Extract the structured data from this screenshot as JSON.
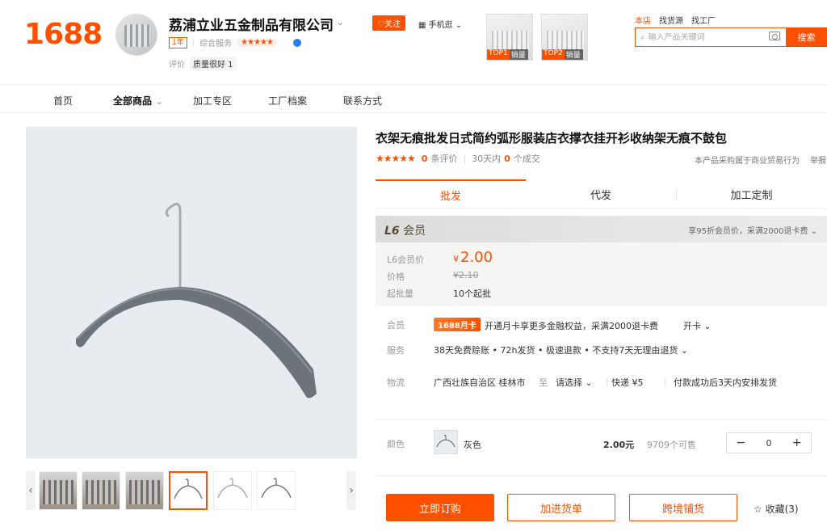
{
  "header": {
    "logo": "1688",
    "shop_name": "荔浦立业五金制品有限公司",
    "year_badge": "1年",
    "service_label": "综合服务",
    "service_stars": "★★★★★",
    "eval_label": "评价",
    "eval_tag": "质量很好 1",
    "follow": "♡关注",
    "mobile": "▦ 手机逛 ⌄",
    "top_products": [
      {
        "rank": "TOP1",
        "label": "销量"
      },
      {
        "rank": "TOP2",
        "label": "销量"
      }
    ],
    "search_tabs": [
      "本店",
      "找货源",
      "找工厂"
    ],
    "search_placeholder": "输入产品关键词",
    "search_button": "搜索"
  },
  "nav": [
    "首页",
    "全部商品",
    "加工专区",
    "工厂档案",
    "联系方式"
  ],
  "gallery": {
    "prev": "‹",
    "next": "›"
  },
  "product": {
    "title": "衣架无痕批发日式简约弧形服装店衣撑衣挂开衫收纳架无痕不鼓包",
    "stars": "★★★★★",
    "review_count": "0",
    "review_label": "条评价",
    "days_label": "30天内",
    "deal_count": "0",
    "deal_label": "个成交",
    "trade_note": "本产品采购属于商业贸易行为",
    "report": "举报"
  },
  "tabs": [
    "批发",
    "代发",
    "加工定制"
  ],
  "price": {
    "member_level": "L6",
    "member_word": "会员",
    "benefit": "享95折会员价，采满2000退卡费 ⌄",
    "member_price_label": "L6会员价",
    "currency": "¥",
    "member_price": "2.00",
    "price_label": "价格",
    "orig_price": "¥2.10",
    "moq_label": "起批量",
    "moq": "10个起批"
  },
  "info": {
    "member_label": "会员",
    "card_badge": "1688月卡",
    "card_text": "开通月卡享更多金融权益，采满2000退卡费",
    "card_action": "开卡 ⌄",
    "service_label": "服务",
    "service_text": "38天免费赊账 • 72h发货 • 极速退款 • 不支持7天无理由退货 ⌄",
    "logistics_label": "物流",
    "from": "广西壮族自治区 桂林市",
    "to_word": "至",
    "dest": "请选择 ⌄",
    "express": "快递 ¥5",
    "ship_note": "付款成功后3天内安排发货"
  },
  "sku": {
    "color_label": "颜色",
    "color_name": "灰色",
    "price": "2.00元",
    "stock": "9709个可售",
    "minus": "−",
    "qty": "0",
    "plus": "+"
  },
  "actions": {
    "buy": "立即订购",
    "cart": "加进货单",
    "cross": "跨境铺货",
    "fav": "☆ 收藏(3)"
  }
}
